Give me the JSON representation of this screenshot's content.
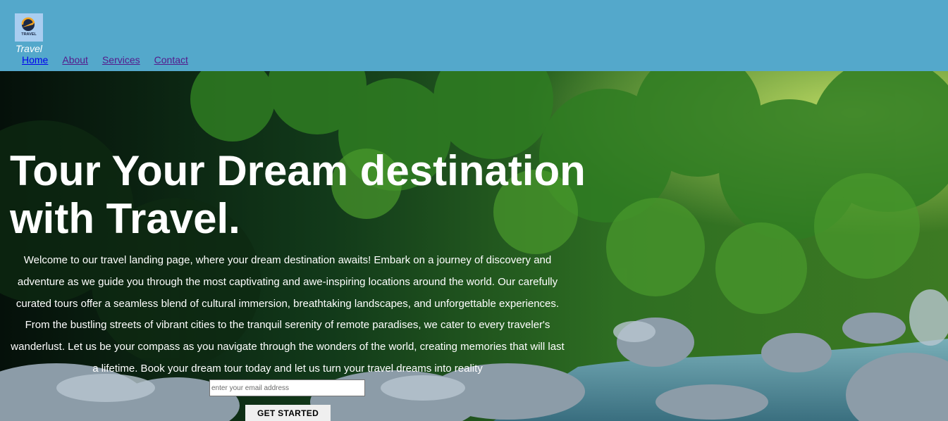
{
  "header": {
    "logo_badge_text": "TRAVEL",
    "logo_text": "Travel",
    "nav": {
      "home": "Home",
      "about": "About",
      "services": "Services",
      "contact": "Contact"
    }
  },
  "hero": {
    "title_line1": "Tour Your Dream destination",
    "title_line2": "with Travel.",
    "description": "Welcome to our travel landing page, where your dream destination awaits! Embark on a journey of discovery and adventure as we guide you through the most captivating and awe-inspiring locations around the world. Our carefully curated tours offer a seamless blend of cultural immersion, breathtaking landscapes, and unforgettable experiences. From the bustling streets of vibrant cities to the tranquil serenity of remote paradises, we cater to every traveler's wanderlust. Let us be your compass as you navigate through the wonders of the world, creating memories that will last a lifetime. Book your dream tour today and let us turn your travel dreams into reality",
    "email_placeholder": "enter your email address",
    "cta_label": "GET STARTED",
    "background_image": "forest river with rocks"
  },
  "colors": {
    "header_bg": "#54a8cb",
    "nav_link": "#551a8b",
    "nav_link_active": "#0000ee",
    "hero_text": "#ffffff"
  }
}
